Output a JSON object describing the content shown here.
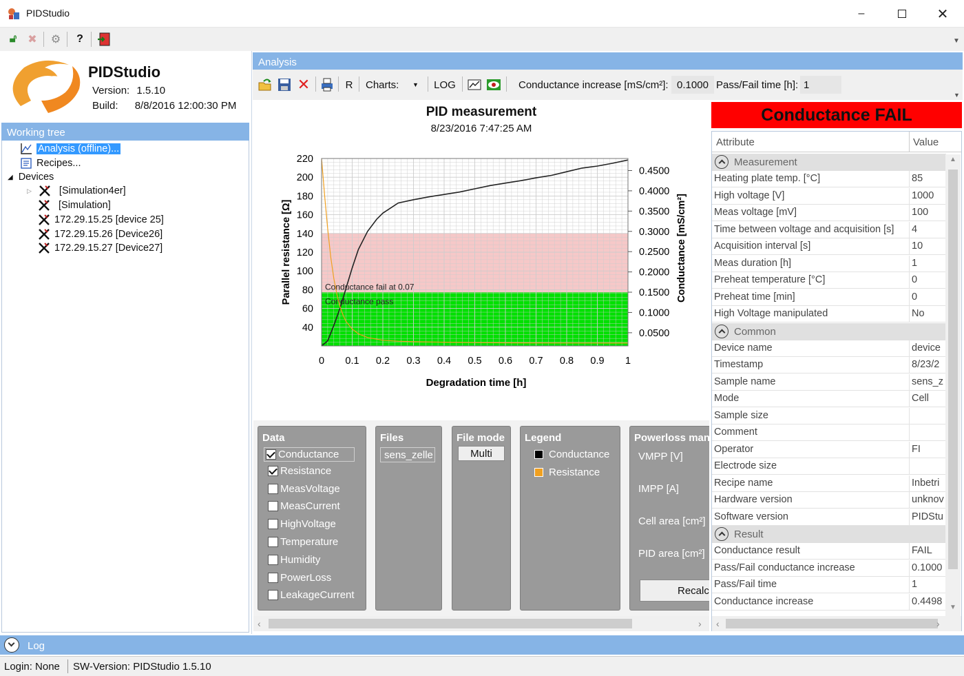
{
  "window": {
    "title": "PIDStudio"
  },
  "about": {
    "app_name": "PIDStudio",
    "version_label": "Version:",
    "version": "1.5.10",
    "build_label": "Build:",
    "build": "8/8/2016 12:00:30 PM"
  },
  "working_tree": {
    "title": "Working tree",
    "analysis": "Analysis (offline)...",
    "recipes": "Recipes...",
    "devices": "Devices",
    "device_items": [
      "[Simulation4er]",
      "[Simulation]",
      "172.29.15.25  [device 25]",
      "172.29.15.26  [Device26]",
      "172.29.15.27  [Device27]"
    ]
  },
  "analysis": {
    "title": "Analysis",
    "r_label": "R",
    "charts_label": "Charts:",
    "log_label": "LOG",
    "cond_increase_label": "Conductance increase [mS/cm²]:",
    "cond_increase_value": "0.1000",
    "passfail_time_label": "Pass/Fail time [h]:",
    "passfail_time_value": "1"
  },
  "chart_data": {
    "type": "line",
    "title": "PID measurement",
    "subtitle": "8/23/2016 7:47:25 AM",
    "xlabel": "Degradation time [h]",
    "ylabel_left": "Parallel resistance [Ω]",
    "ylabel_right": "Conductance [mS/cm²]",
    "xlim": [
      0,
      1
    ],
    "ylim_left": [
      20,
      220
    ],
    "ylim_right": [
      0.0175,
      0.4797
    ],
    "x_ticks": [
      "0",
      "0.1",
      "0.2",
      "0.3",
      "0.4",
      "0.5",
      "0.6",
      "0.7",
      "0.8",
      "0.9",
      "1"
    ],
    "y_ticks_left": [
      "220",
      "200",
      "180",
      "160",
      "140",
      "120",
      "100",
      "80",
      "60",
      "40"
    ],
    "y_ticks_right": [
      "0.4500",
      "0.4000",
      "0.3500",
      "0.3000",
      "0.2500",
      "0.2000",
      "0.1500",
      "0.1000",
      "0.0500"
    ],
    "grid": true,
    "bands": [
      {
        "label": "Conductance fail at 0.07",
        "from": 0.1495,
        "to": 0.2955,
        "color": "#f6c8c8"
      },
      {
        "label": "Conductance pass",
        "from": 0.0175,
        "to": 0.1495,
        "color": "#00e000"
      }
    ],
    "series": [
      {
        "name": "Conductance",
        "axis": "right",
        "color": "#222222",
        "x": [
          0.0,
          0.02,
          0.04,
          0.06,
          0.08,
          0.1,
          0.12,
          0.15,
          0.18,
          0.2,
          0.25,
          0.3,
          0.35,
          0.4,
          0.45,
          0.5,
          0.55,
          0.6,
          0.65,
          0.7,
          0.75,
          0.8,
          0.85,
          0.9,
          0.95,
          1.0
        ],
        "y": [
          0.0175,
          0.03,
          0.068,
          0.11,
          0.16,
          0.21,
          0.255,
          0.3,
          0.33,
          0.345,
          0.37,
          0.378,
          0.385,
          0.391,
          0.397,
          0.405,
          0.413,
          0.419,
          0.425,
          0.432,
          0.438,
          0.447,
          0.456,
          0.461,
          0.468,
          0.476
        ]
      },
      {
        "name": "Resistance",
        "axis": "left",
        "color": "#f0a020",
        "x": [
          0.0,
          0.01,
          0.02,
          0.03,
          0.04,
          0.05,
          0.06,
          0.07,
          0.08,
          0.1,
          0.12,
          0.15,
          0.2,
          0.25,
          0.3,
          0.4,
          0.5,
          0.6,
          0.8,
          1.0
        ],
        "y": [
          220,
          180,
          145,
          115,
          92,
          75,
          62,
          53,
          46,
          38,
          33,
          29,
          26,
          25,
          24.5,
          24,
          23.5,
          23.3,
          23.1,
          23.0
        ]
      }
    ]
  },
  "panels": {
    "data": {
      "title": "Data",
      "items": [
        {
          "label": "Conductance",
          "checked": true
        },
        {
          "label": "Resistance",
          "checked": true
        },
        {
          "label": "MeasVoltage",
          "checked": false
        },
        {
          "label": "MeasCurrent",
          "checked": false
        },
        {
          "label": "HighVoltage",
          "checked": false
        },
        {
          "label": "Temperature",
          "checked": false
        },
        {
          "label": "Humidity",
          "checked": false
        },
        {
          "label": "PowerLoss",
          "checked": false
        },
        {
          "label": "LeakageCurrent",
          "checked": false
        }
      ]
    },
    "files": {
      "title": "Files",
      "item": "sens_zelle"
    },
    "file_mode": {
      "title": "File mode",
      "button": "Multi"
    },
    "legend": {
      "title": "Legend",
      "items": [
        {
          "label": "Conductance",
          "color": "#000000"
        },
        {
          "label": "Resistance",
          "color": "#f0a020"
        }
      ]
    },
    "powerloss": {
      "title": "Powerloss man",
      "labels": [
        "VMPP [V]",
        "IMPP [A]",
        "Cell area [cm²]",
        "PID area [cm²]"
      ],
      "button": "Recalc"
    }
  },
  "result": {
    "banner": "Conductance FAIL",
    "banner_color": "#ff0000",
    "header_attr": "Attribute",
    "header_val": "Value",
    "categories": [
      {
        "name": "Measurement",
        "rows": [
          [
            "Heating plate temp. [°C]",
            "85"
          ],
          [
            "High voltage [V]",
            "1000"
          ],
          [
            "Meas voltage [mV]",
            "100"
          ],
          [
            "Time between voltage and acquisition [s]",
            "4"
          ],
          [
            "Acquisition interval [s]",
            "10"
          ],
          [
            "Meas duration [h]",
            "1"
          ],
          [
            "Preheat temperature [°C]",
            "0"
          ],
          [
            "Preheat time [min]",
            "0"
          ],
          [
            "High Voltage manipulated",
            "No"
          ]
        ]
      },
      {
        "name": "Common",
        "rows": [
          [
            "Device name",
            "device"
          ],
          [
            "Timestamp",
            "8/23/2"
          ],
          [
            "Sample name",
            "sens_z"
          ],
          [
            "Mode",
            "Cell"
          ],
          [
            "Sample size",
            ""
          ],
          [
            "Comment",
            ""
          ],
          [
            "Operator",
            "FI"
          ],
          [
            "Electrode size",
            ""
          ],
          [
            "Recipe name",
            "Inbetri"
          ],
          [
            "Hardware version",
            "unknov"
          ],
          [
            "Software version",
            "PIDStu"
          ]
        ]
      },
      {
        "name": "Result",
        "rows": [
          [
            "Conductance result",
            "FAIL"
          ],
          [
            "Pass/Fail conductance increase",
            "0.1000"
          ],
          [
            "Pass/Fail time",
            "1"
          ],
          [
            "Conductance increase",
            "0.4498"
          ]
        ]
      }
    ]
  },
  "log": {
    "title": "Log"
  },
  "status": {
    "login": "Login:  None",
    "sw": "SW-Version:  PIDStudio 1.5.10"
  }
}
